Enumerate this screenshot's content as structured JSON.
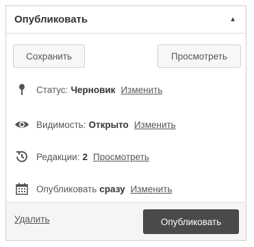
{
  "panel": {
    "title": "Опубликовать",
    "toggle_icon": "triangle-up-icon"
  },
  "buttons": {
    "save_label": "Сохранить",
    "preview_label": "Просмотреть"
  },
  "status": {
    "icon": "pin-icon",
    "label": "Статус:",
    "value": "Черновик",
    "edit_link": "Изменить"
  },
  "visibility": {
    "icon": "eye-icon",
    "label": "Видимость:",
    "value": "Открыто",
    "edit_link": "Изменить"
  },
  "revisions": {
    "icon": "history-icon",
    "label": "Редакции:",
    "value": "2",
    "view_link": "Просмотреть"
  },
  "schedule": {
    "icon": "calendar-icon",
    "label": "Опубликовать",
    "value": "сразу",
    "edit_link": "Изменить"
  },
  "footer": {
    "delete_link": "Удалить",
    "publish_label": "Опубликовать"
  },
  "colors": {
    "publish_button": "#4a4a4a",
    "footer_bg": "#f5f5f5",
    "border": "#cfcfcf"
  }
}
